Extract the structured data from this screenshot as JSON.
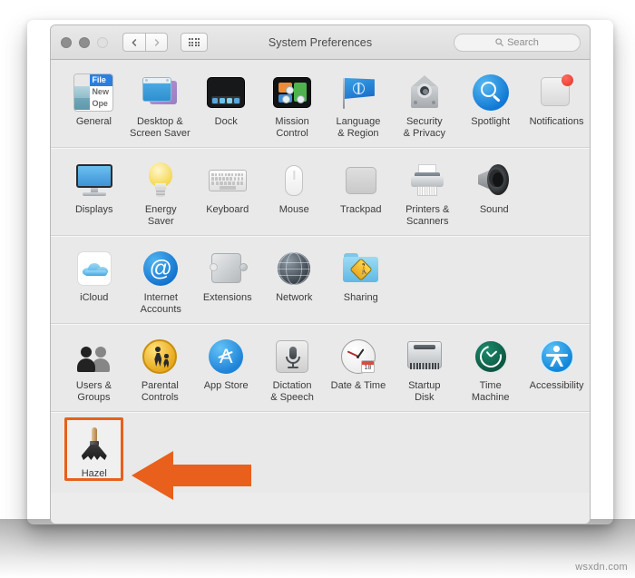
{
  "window": {
    "title": "System Preferences",
    "search_placeholder": "Search",
    "traffic_lights": [
      "close-button",
      "minimize-button",
      "zoom-button"
    ],
    "nav_back": "‹",
    "nav_forward": "›",
    "grid_button": "show-all-button"
  },
  "rows": [
    {
      "name": "personal",
      "items": [
        {
          "label": "General",
          "icon": "general-icon"
        },
        {
          "label": "Desktop &\nScreen Saver",
          "icon": "desktop-screensaver-icon"
        },
        {
          "label": "Dock",
          "icon": "dock-icon"
        },
        {
          "label": "Mission\nControl",
          "icon": "mission-control-icon"
        },
        {
          "label": "Language\n& Region",
          "icon": "language-region-icon"
        },
        {
          "label": "Security\n& Privacy",
          "icon": "security-privacy-icon"
        },
        {
          "label": "Spotlight",
          "icon": "spotlight-icon"
        },
        {
          "label": "Notifications",
          "icon": "notifications-icon"
        }
      ]
    },
    {
      "name": "hardware",
      "items": [
        {
          "label": "Displays",
          "icon": "displays-icon"
        },
        {
          "label": "Energy\nSaver",
          "icon": "energy-saver-icon"
        },
        {
          "label": "Keyboard",
          "icon": "keyboard-icon"
        },
        {
          "label": "Mouse",
          "icon": "mouse-icon"
        },
        {
          "label": "Trackpad",
          "icon": "trackpad-icon"
        },
        {
          "label": "Printers &\nScanners",
          "icon": "printers-scanners-icon"
        },
        {
          "label": "Sound",
          "icon": "sound-icon"
        }
      ]
    },
    {
      "name": "internet-and-wireless",
      "items": [
        {
          "label": "iCloud",
          "icon": "icloud-icon"
        },
        {
          "label": "Internet\nAccounts",
          "icon": "internet-accounts-icon"
        },
        {
          "label": "Extensions",
          "icon": "extensions-icon"
        },
        {
          "label": "Network",
          "icon": "network-icon"
        },
        {
          "label": "Sharing",
          "icon": "sharing-icon"
        }
      ]
    },
    {
      "name": "system",
      "items": [
        {
          "label": "Users &\nGroups",
          "icon": "users-groups-icon"
        },
        {
          "label": "Parental\nControls",
          "icon": "parental-controls-icon"
        },
        {
          "label": "App Store",
          "icon": "app-store-icon"
        },
        {
          "label": "Dictation\n& Speech",
          "icon": "dictation-speech-icon"
        },
        {
          "label": "Date & Time",
          "icon": "date-time-icon"
        },
        {
          "label": "Startup\nDisk",
          "icon": "startup-disk-icon"
        },
        {
          "label": "Time\nMachine",
          "icon": "time-machine-icon"
        },
        {
          "label": "Accessibility",
          "icon": "accessibility-icon"
        }
      ]
    },
    {
      "name": "third-party",
      "items": [
        {
          "label": "Hazel",
          "icon": "hazel-icon",
          "selected": true
        }
      ]
    }
  ],
  "annotation": {
    "type": "left-pointing-arrow",
    "color": "#E8601C",
    "points_to": "Hazel"
  },
  "watermark": "wsxdn.com",
  "colors": {
    "window_bg": "#e9e9e9",
    "titlebar": "#dcdcdc",
    "label_text": "#3b3b3b",
    "highlight": "#E8601C"
  }
}
